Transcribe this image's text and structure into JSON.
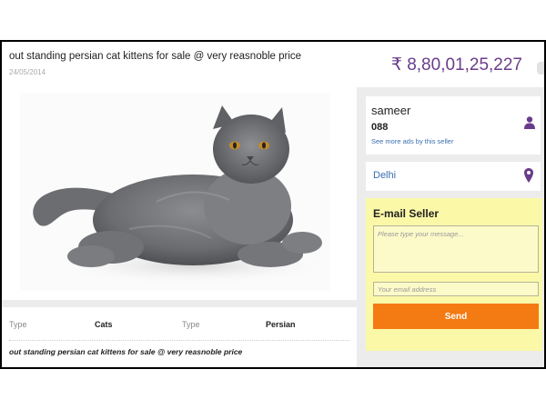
{
  "listing": {
    "title": "out standing persian cat kittens for sale @ very reasnoble price",
    "date": "24/05/2014",
    "price": "₹ 8,80,01,25,227",
    "photo_icon": "persian-cat-photo"
  },
  "details": {
    "type1_label": "Type",
    "type1_value": "Cats",
    "type2_label": "Type",
    "type2_value": "Persian",
    "description": "out standing persian cat kittens for sale @ very reasnoble price"
  },
  "seller": {
    "name": "sameer",
    "phone": "088",
    "more_ads_link": "See more ads by this seller",
    "icon": "person-icon"
  },
  "location": {
    "city": "Delhi",
    "icon": "map-pin-icon"
  },
  "email_seller": {
    "title": "E-mail Seller",
    "message_placeholder": "Please type your message...",
    "email_placeholder": "Your email address",
    "send_label": "Send"
  },
  "colors": {
    "accent_purple": "#6a3c8c",
    "link_blue": "#3a6fb0",
    "email_panel_bg": "#fbf8a8",
    "send_button": "#f47a13"
  }
}
